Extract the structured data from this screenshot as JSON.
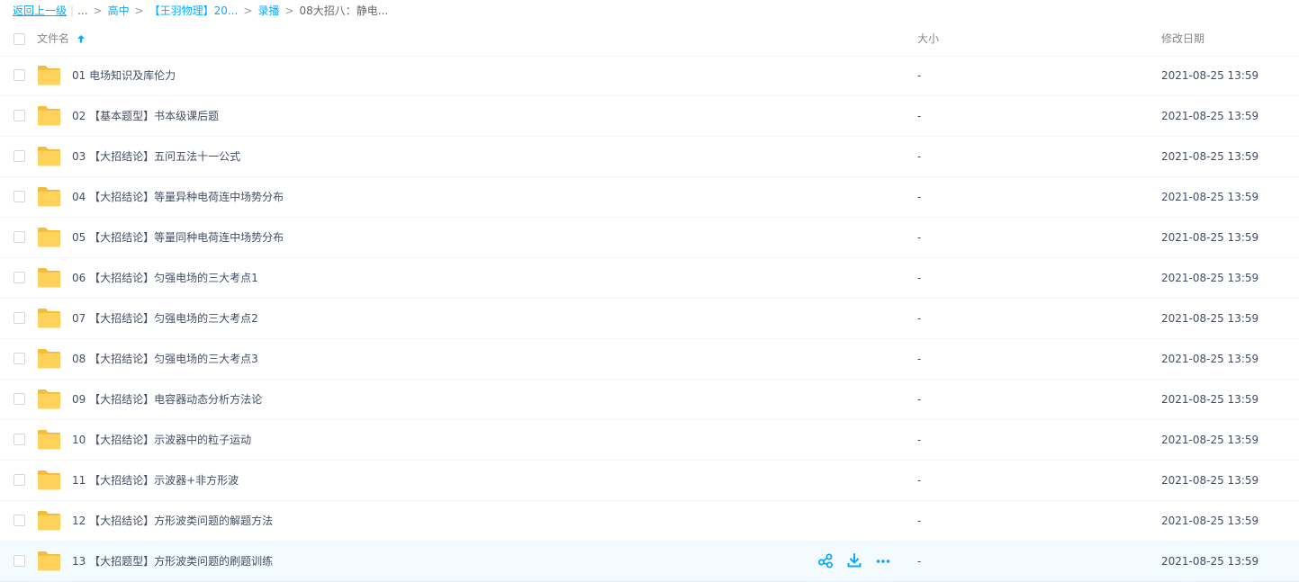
{
  "breadcrumb": {
    "back": "返回上一级",
    "ellipsis": "...",
    "items": [
      "高中",
      "【王羽物理】20...",
      "录播"
    ],
    "current": "08大招八：静电..."
  },
  "columns": {
    "name": "文件名",
    "size": "大小",
    "date": "修改日期"
  },
  "icons": {
    "folder": "folder-icon",
    "sort": "sort-arrow-up-icon",
    "share": "share-icon",
    "download": "download-icon",
    "more": "more-icon"
  },
  "colors": {
    "accent": "#09aaff",
    "folder": "#ffd35b",
    "hover_row": "#f4fbff"
  },
  "rows": [
    {
      "name": "01 电场知识及库伦力",
      "size": "-",
      "date": "2021-08-25 13:59"
    },
    {
      "name": "02 【基本题型】书本级课后题",
      "size": "-",
      "date": "2021-08-25 13:59"
    },
    {
      "name": "03 【大招结论】五问五法十一公式",
      "size": "-",
      "date": "2021-08-25 13:59"
    },
    {
      "name": "04 【大招结论】等量异种电荷连中场势分布",
      "size": "-",
      "date": "2021-08-25 13:59"
    },
    {
      "name": "05 【大招结论】等量同种电荷连中场势分布",
      "size": "-",
      "date": "2021-08-25 13:59"
    },
    {
      "name": "06 【大招结论】匀强电场的三大考点1",
      "size": "-",
      "date": "2021-08-25 13:59"
    },
    {
      "name": "07 【大招结论】匀强电场的三大考点2",
      "size": "-",
      "date": "2021-08-25 13:59"
    },
    {
      "name": "08 【大招结论】匀强电场的三大考点3",
      "size": "-",
      "date": "2021-08-25 13:59"
    },
    {
      "name": "09 【大招结论】电容器动态分析方法论",
      "size": "-",
      "date": "2021-08-25 13:59"
    },
    {
      "name": "10 【大招结论】示波器中的粒子运动",
      "size": "-",
      "date": "2021-08-25 13:59"
    },
    {
      "name": "11 【大招结论】示波器+非方形波",
      "size": "-",
      "date": "2021-08-25 13:59"
    },
    {
      "name": "12 【大招结论】方形波类问题的解题方法",
      "size": "-",
      "date": "2021-08-25 13:59"
    },
    {
      "name": "13 【大招题型】方形波类问题的刷题训练",
      "size": "-",
      "date": "2021-08-25 13:59"
    }
  ]
}
